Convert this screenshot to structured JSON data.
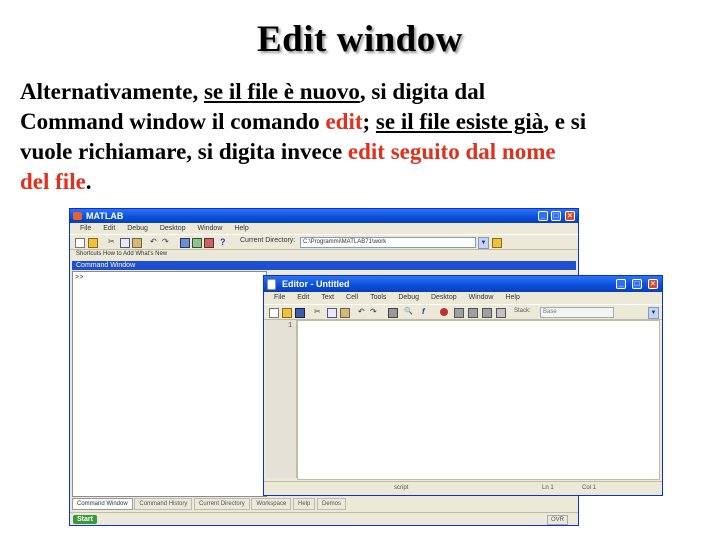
{
  "slide": {
    "title": "Edit window",
    "text": {
      "t1": "Alternativamente, ",
      "t2": "se il file è nuovo",
      "t3": ", si digita dal",
      "t4": "Command window il comando ",
      "t5": "edit",
      "t6": "; ",
      "t7": "se il file esiste già",
      "t8": ", e si",
      "t9": "vuole richiamare, si digita invece ",
      "t10": "edit seguito dal nome",
      "t11": "del file",
      "t12": "."
    }
  },
  "matlab": {
    "title": "MATLAB",
    "menu": [
      "File",
      "Edit",
      "Debug",
      "Desktop",
      "Window",
      "Help"
    ],
    "current_dir_label": "Current Directory:",
    "current_dir_value": "C:\\Programmi\\MATLAB71\\work",
    "shortcuts": "Shortcuts  How to Add  What's New",
    "command_window_title": "Command Window",
    "prompt": ">>",
    "tabs": [
      "Command Window",
      "Command History",
      "Current Directory",
      "Workspace",
      "Help",
      "Demos"
    ],
    "start_label": "Start",
    "status_ovr": "OVR"
  },
  "editor": {
    "title": "Editor - Untitled",
    "menu": [
      "File",
      "Edit",
      "Text",
      "Cell",
      "Tools",
      "Debug",
      "Desktop",
      "Window",
      "Help"
    ],
    "stack_label": "Stack:",
    "stack_value": "Base",
    "line_number": "1",
    "status_script": "script",
    "status_ln": "Ln 1",
    "status_col": "Col 1"
  },
  "colors": {
    "xp_blue": "#0b4ed8",
    "accent_red": "#e0301e",
    "window_face": "#ece9d8"
  }
}
